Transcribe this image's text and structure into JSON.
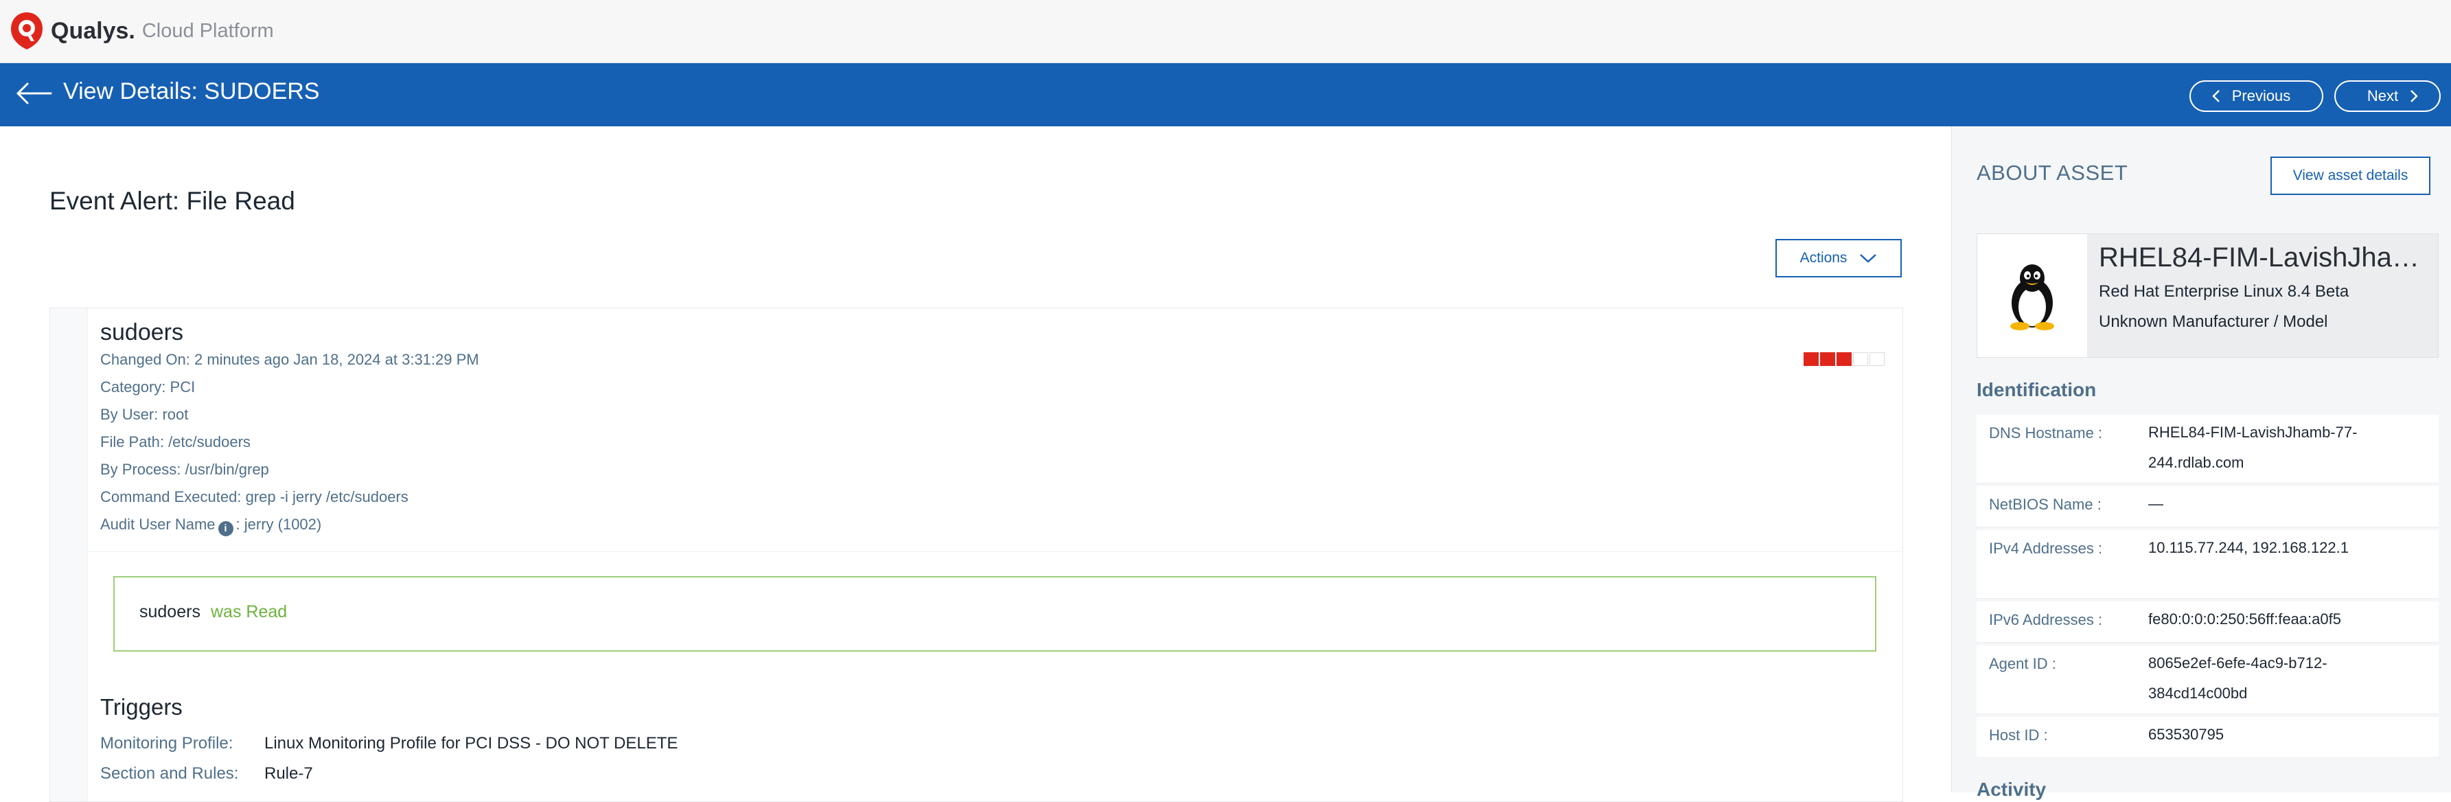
{
  "header": {
    "brand": "Qualys.",
    "brand_sub": "Cloud Platform"
  },
  "titlebar": {
    "title": "View Details: SUDOERS",
    "previous_label": "Previous",
    "next_label": "Next"
  },
  "event": {
    "title": "Event Alert:  File Read",
    "actions_label": "Actions",
    "file_name": "sudoers",
    "changed_on_label": "Changed On:",
    "changed_on_value": "2 minutes ago Jan 18, 2024 at 3:31:29 PM",
    "category_label": "Category:",
    "category_value": "PCI",
    "by_user_label": "By User:",
    "by_user_value": "root",
    "file_path_label": "File Path:",
    "file_path_value": "/etc/sudoers",
    "by_process_label": "By Process:",
    "by_process_value": "/usr/bin/grep",
    "command_label": "Command Executed:",
    "command_value": "grep -i jerry /etc/sudoers",
    "audit_user_label": "Audit User Name",
    "audit_user_value": ": jerry (1002)",
    "severity_level": 3,
    "severity_max": 5,
    "read_file": "sudoers",
    "read_action": "was Read",
    "triggers_title": "Triggers",
    "monitoring_profile_label": "Monitoring Profile:",
    "monitoring_profile_value": "Linux Monitoring Profile for PCI DSS - DO NOT DELETE",
    "section_rules_label": "Section and Rules:",
    "section_rules_value": "Rule-7"
  },
  "asset": {
    "about_title": "ABOUT ASSET",
    "view_details_label": "View asset details",
    "name": "RHEL84-FIM-LavishJhamb-77-244",
    "os": "Red Hat Enterprise Linux 8.4 Beta",
    "manufacturer": "Unknown Manufacturer / Model",
    "os_icon": "linux-tux-icon",
    "identification_title": "Identification",
    "identification": [
      {
        "label": "DNS Hostname :",
        "value": "RHEL84-FIM-LavishJhamb-77-244.rdlab.com"
      },
      {
        "label": "NetBIOS Name :",
        "value": "—"
      },
      {
        "label": "IPv4 Addresses :",
        "value": "10.115.77.244, 192.168.122.1"
      },
      {
        "label": "IPv6 Addresses :",
        "value": "fe80:0:0:0:250:56ff:feaa:a0f5"
      },
      {
        "label": "Agent ID :",
        "value": "8065e2ef-6efe-4ac9-b712-384cd14c00bd"
      },
      {
        "label": "Host ID :",
        "value": "653530795"
      }
    ],
    "activity_title": "Activity"
  },
  "colors": {
    "brand_blue": "#1660b3",
    "severity_red": "#e0261b",
    "read_green": "#6db33f",
    "label_slate": "#4f6f8b"
  }
}
